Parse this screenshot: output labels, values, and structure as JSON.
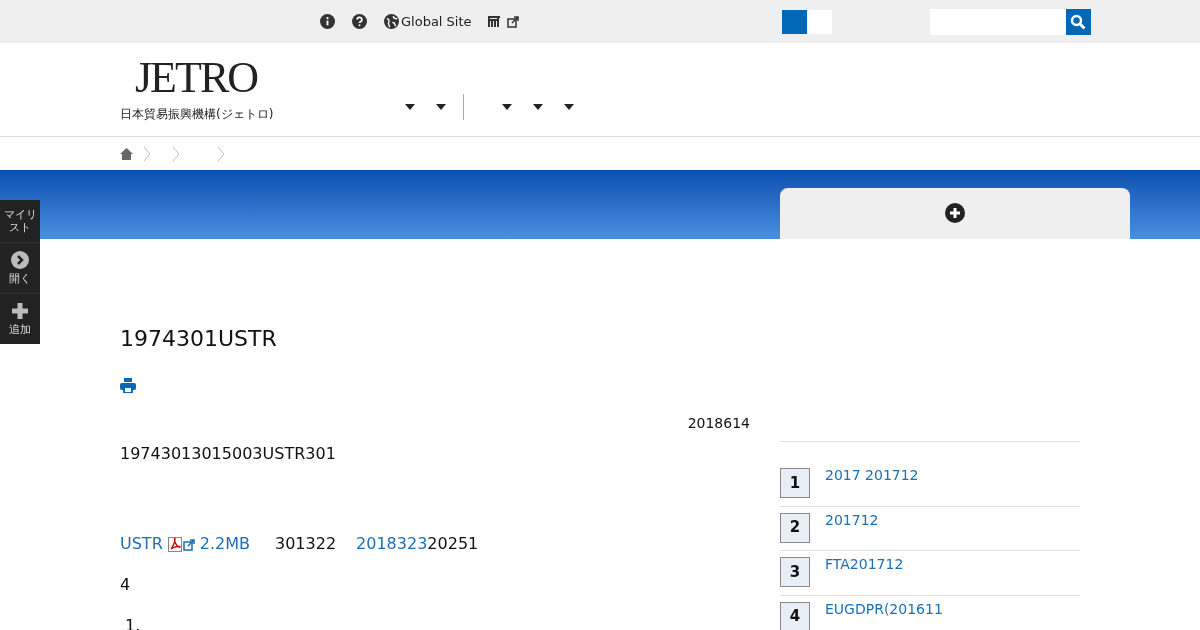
{
  "top_bar": {
    "global_site": "Global Site"
  },
  "logo": {
    "wordmark": "JETRO",
    "subtitle": "日本貿易振興機構(ジェトロ)"
  },
  "side_panel": {
    "items": [
      {
        "kind": "mylist",
        "label": "マイリスト"
      },
      {
        "kind": "open",
        "label": "開く"
      },
      {
        "kind": "add",
        "label": "追加"
      }
    ]
  },
  "article": {
    "title": "1974301USTR",
    "date": "2018614",
    "lead": "19743013015003USTR301",
    "source_line": [
      {
        "kind": "link",
        "text": "USTR"
      },
      {
        "kind": "pdf"
      },
      {
        "kind": "link",
        "text": "2.2MB"
      },
      {
        "kind": "text",
        "text": "301322"
      },
      {
        "kind": "link",
        "text": "2018323"
      },
      {
        "kind": "plain",
        "text": "20251"
      }
    ],
    "count": "4",
    "list_start": "1."
  },
  "ranking": {
    "items": [
      {
        "rank": "1",
        "title": "2017 201712"
      },
      {
        "rank": "2",
        "title": "201712"
      },
      {
        "rank": "3",
        "title": "FTA201712"
      },
      {
        "rank": "4",
        "title": "EUGDPR(201611"
      }
    ]
  }
}
